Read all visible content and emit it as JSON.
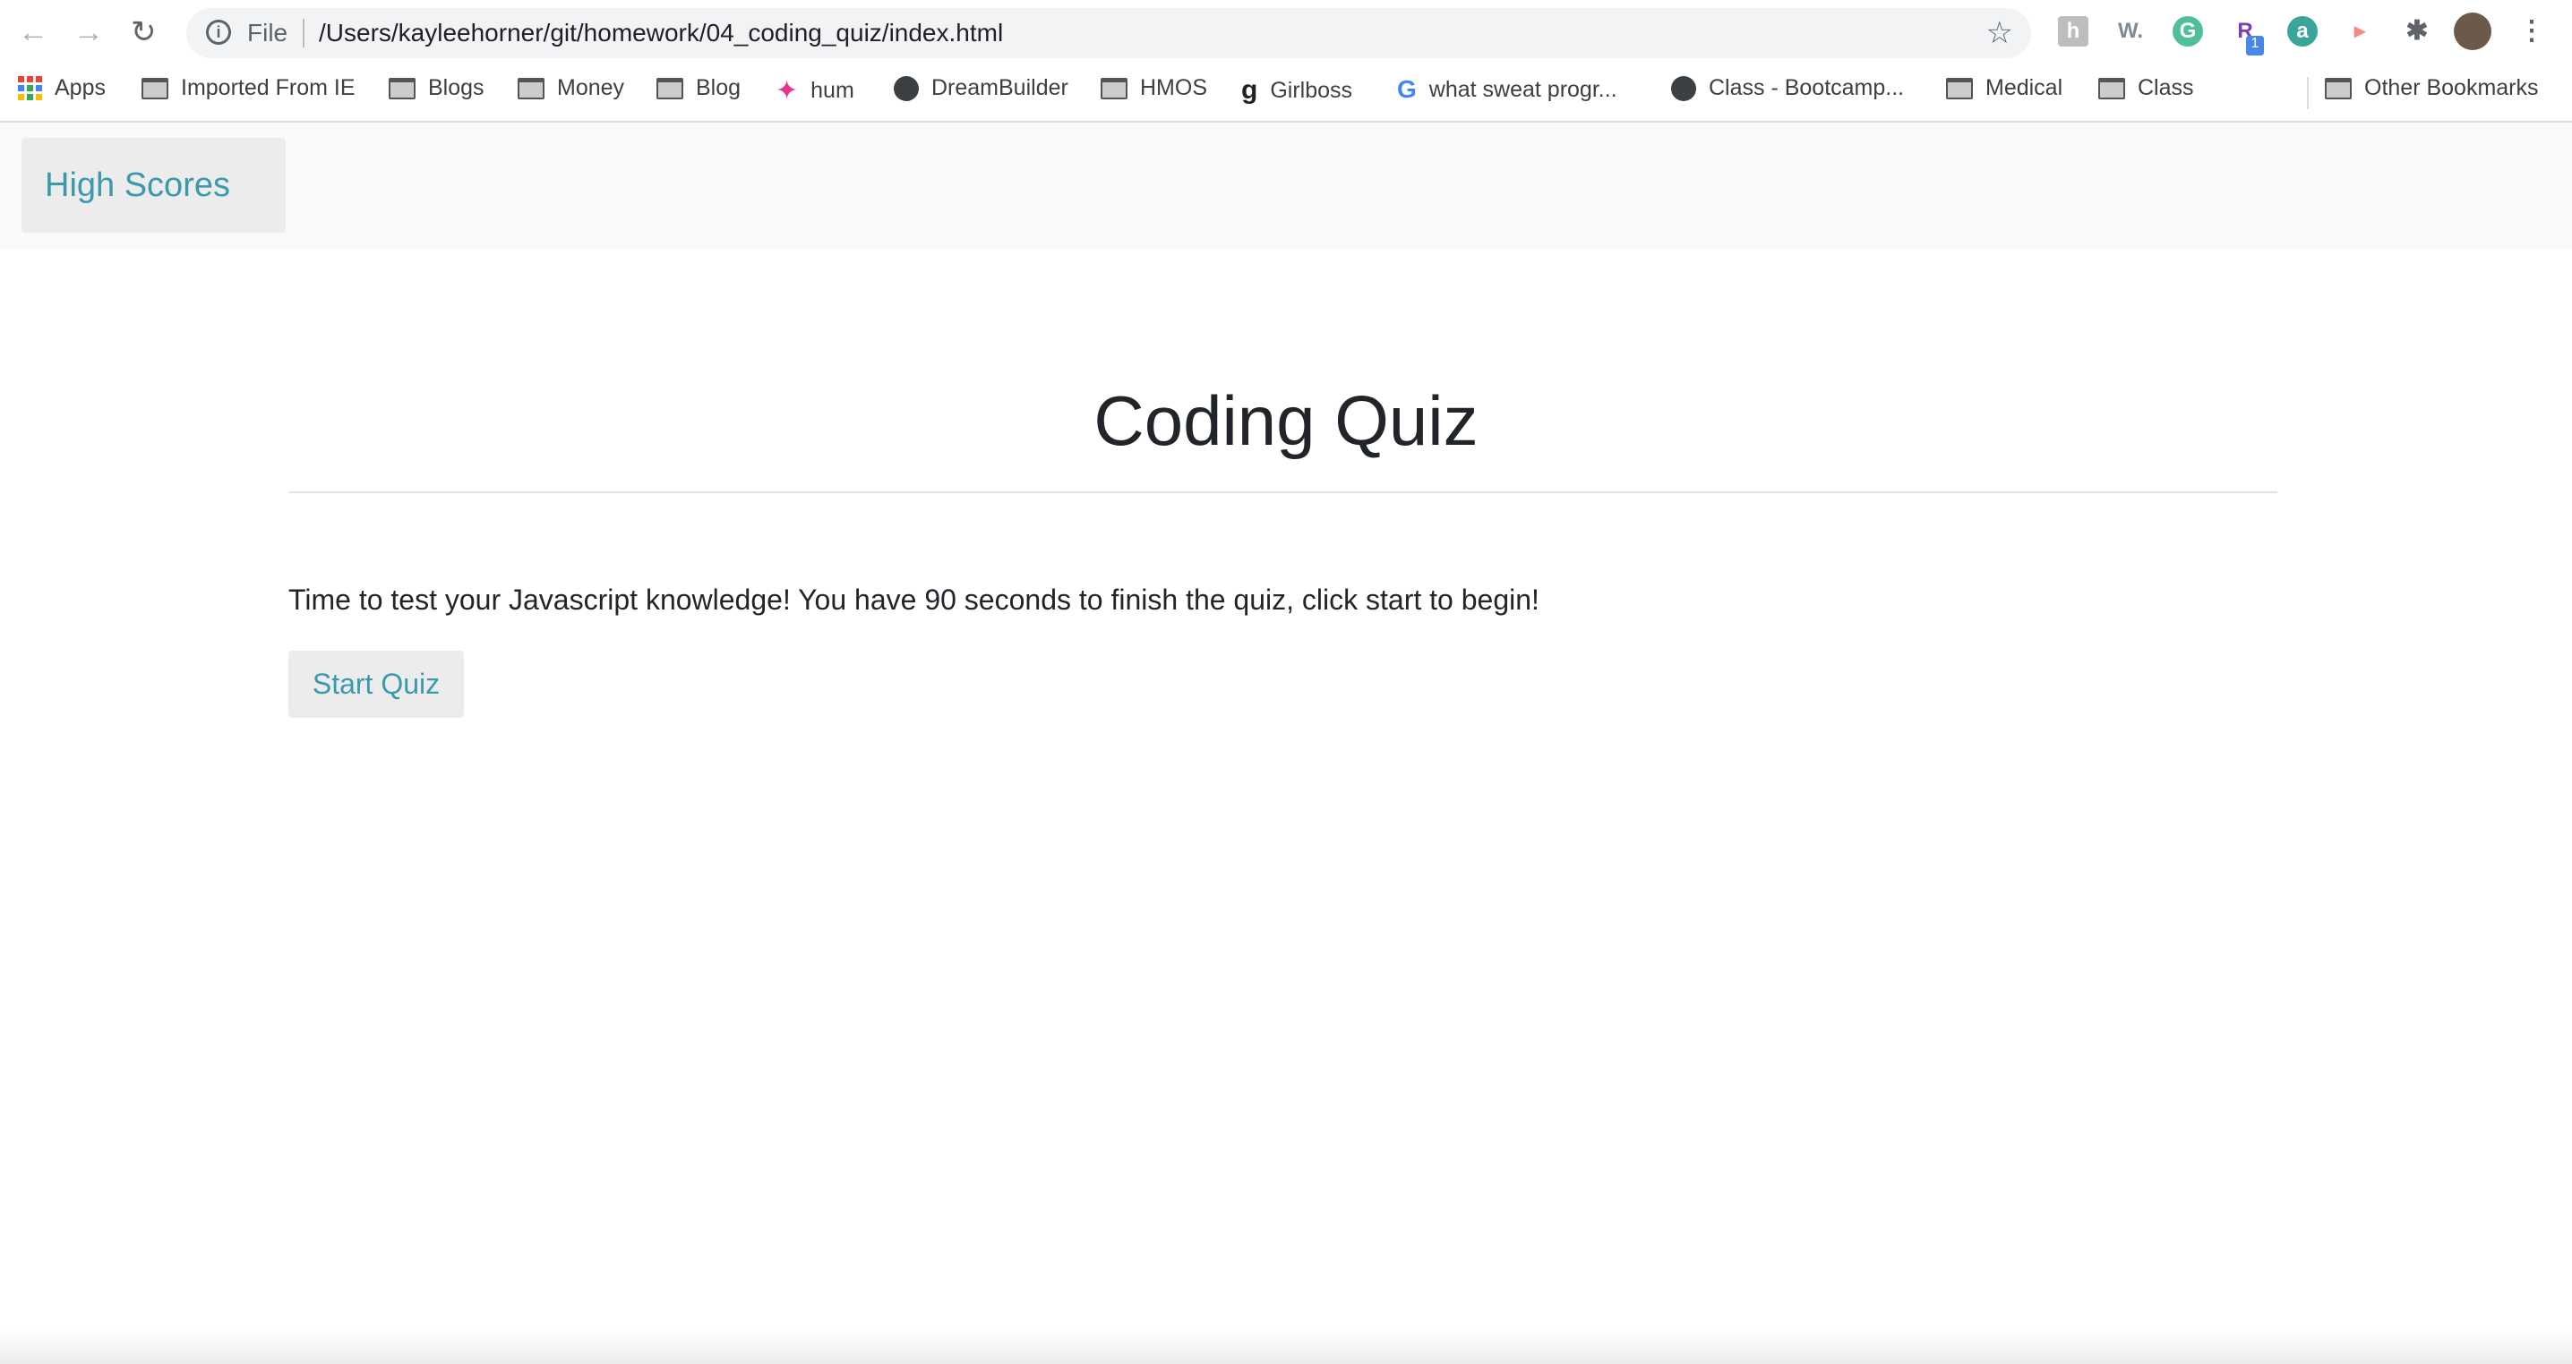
{
  "browser": {
    "address": {
      "scheme_label": "File",
      "url": "/Users/kayleehorner/git/homework/04_coding_quiz/index.html"
    },
    "extensions": [
      {
        "name": "h",
        "color": "#bdbdbd"
      },
      {
        "name": "W.",
        "color": "#7d8b93"
      },
      {
        "name": "G",
        "color": "#4fbf9a"
      },
      {
        "name": "R",
        "color": "#7b3fb0",
        "badge": "1"
      },
      {
        "name": "a",
        "color": "#3aa59a"
      },
      {
        "name": "▸",
        "color": "#f28b82"
      }
    ],
    "bookmarks": [
      "Apps",
      "Imported From IE",
      "Blogs",
      "Money",
      "Blog",
      "hum",
      "DreamBuilder",
      "HMOS",
      "Girlboss",
      "what sweat progr...",
      "Class - Bootcamp...",
      "Medical",
      "Class"
    ],
    "other_bookmarks": "Other Bookmarks"
  },
  "page": {
    "nav": {
      "high_scores": "High Scores"
    },
    "title": "Coding Quiz",
    "intro": "Time to test your Javascript knowledge! You have 90 seconds to finish the quiz, click start to begin!",
    "start_label": "Start Quiz"
  },
  "colors": {
    "accent": "#3a9aab",
    "navbar_bg": "#f8f9fa",
    "button_bg": "#ececec"
  }
}
